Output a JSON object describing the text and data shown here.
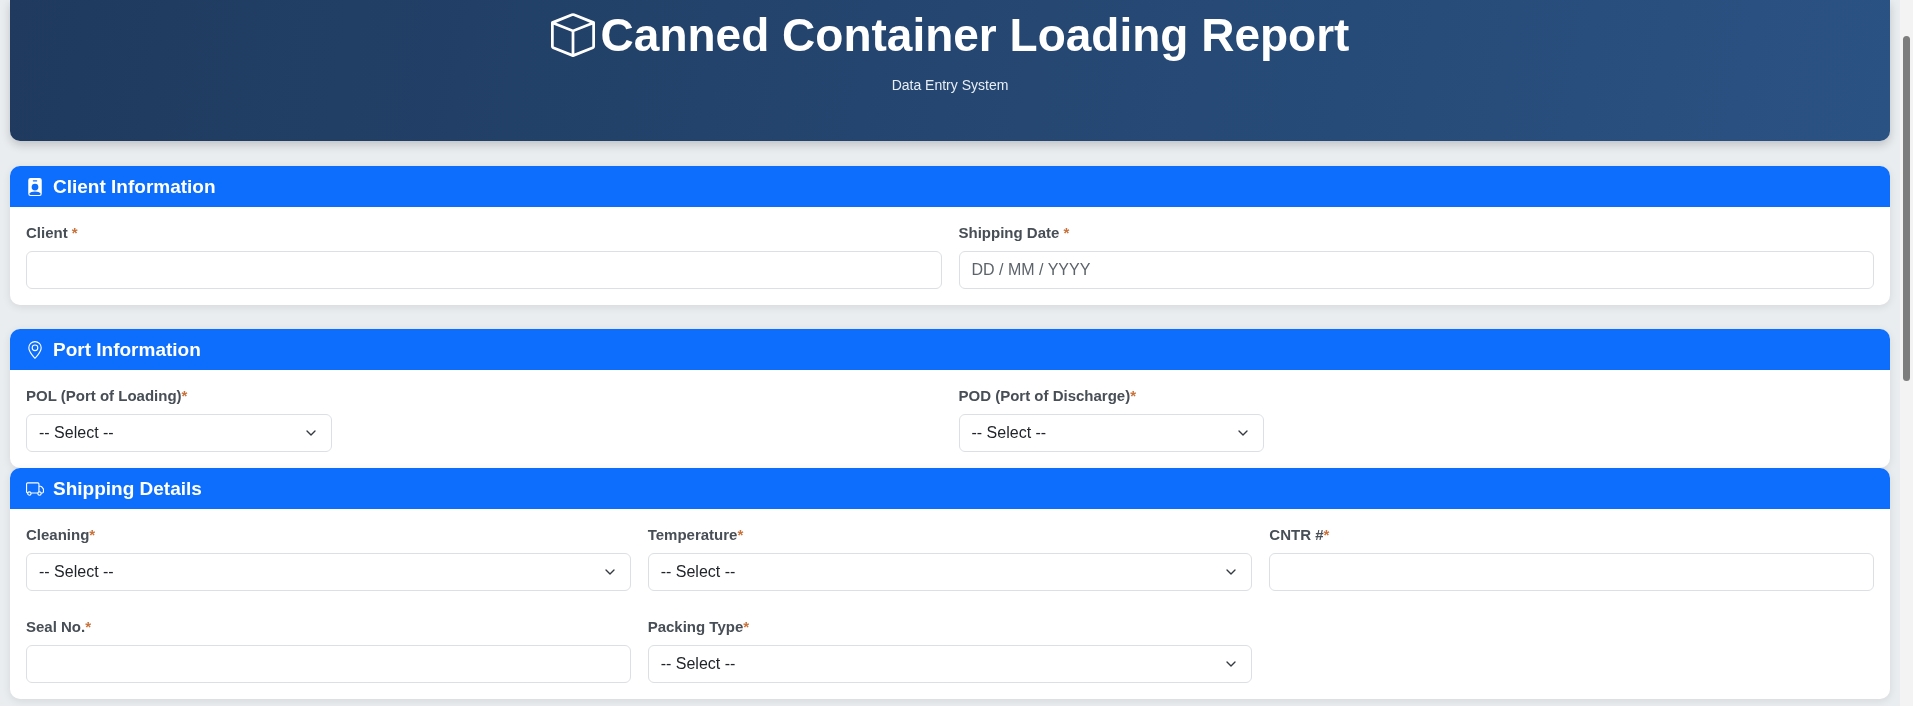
{
  "header": {
    "title": "Canned Container Loading Report",
    "subtitle": "Data Entry System"
  },
  "sections": [
    {
      "kind": "client",
      "title": "Client Information",
      "fields": [
        {
          "kind": "text",
          "label": "Client",
          "mark": " *"
        },
        {
          "kind": "date",
          "label": "Shipping Date",
          "mark": " *",
          "placeholder": "DD / MM / YYYY"
        }
      ]
    },
    {
      "kind": "port",
      "title": "Port Information",
      "fields": [
        {
          "kind": "select",
          "label": "POL (Port of Loading)",
          "mark": "*",
          "value": "-- Select --"
        },
        {
          "kind": "select",
          "label": "POD (Port of Discharge)",
          "mark": "*",
          "value": "-- Select --"
        }
      ]
    },
    {
      "kind": "shipping",
      "title": "Shipping Details",
      "fields": [
        {
          "kind": "select",
          "label": "Cleaning",
          "mark": "*",
          "value": "-- Select --"
        },
        {
          "kind": "select",
          "label": "Temperature",
          "mark": "*",
          "value": "-- Select --"
        },
        {
          "kind": "text",
          "label": "CNTR #",
          "mark": "*"
        },
        {
          "kind": "text",
          "label": "Seal No.",
          "mark": "*"
        },
        {
          "kind": "select",
          "label": "Packing Type",
          "mark": "*",
          "value": "-- Select --"
        }
      ]
    }
  ]
}
